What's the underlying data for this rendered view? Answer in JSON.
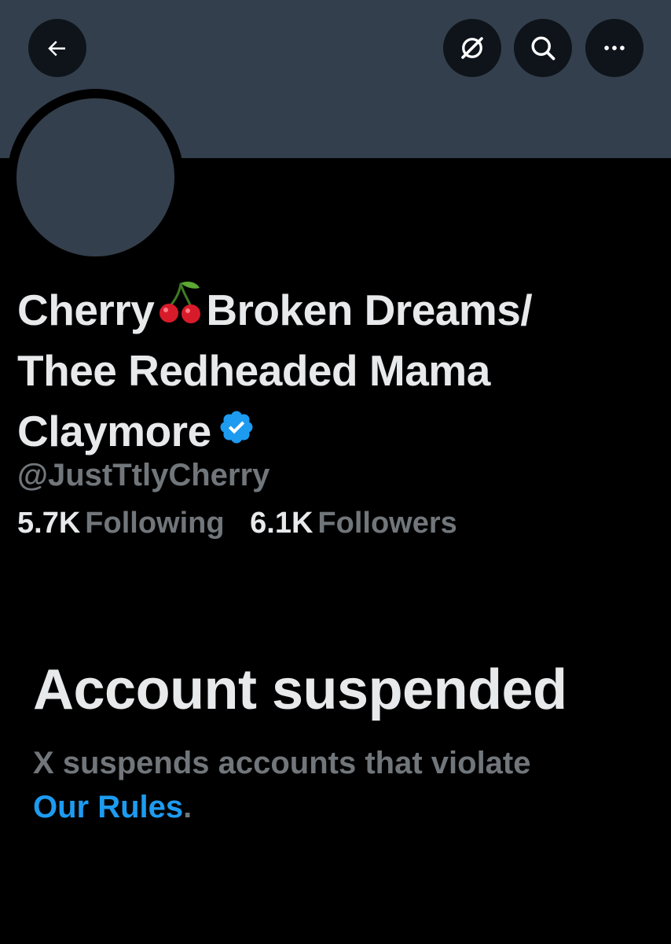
{
  "header": {
    "back_icon": "arrow-left-icon",
    "grok_icon": "grok-icon",
    "search_icon": "search-icon",
    "more_icon": "more-horizontal-icon",
    "banner_color": "#333f4d"
  },
  "profile": {
    "name_part1": "Cherry",
    "name_emoji": "🍒",
    "name_part2": "Broken Dreams/",
    "name_line2": "Thee Redheaded Mama",
    "name_line3": "Claymore",
    "verified_icon": "verified-badge-icon",
    "handle": "@JustTtlyCherry",
    "following_count": "5.7K",
    "following_label": "Following",
    "followers_count": "6.1K",
    "followers_label": "Followers"
  },
  "suspension": {
    "title": "Account suspended",
    "message": "X suspends accounts that violate",
    "link_text": "Our Rules",
    "trailing": "."
  },
  "colors": {
    "background": "#000000",
    "text_primary": "#e7e9ea",
    "text_secondary": "#71767b",
    "link": "#1d9bf0",
    "verified": "#1d9bf0"
  }
}
